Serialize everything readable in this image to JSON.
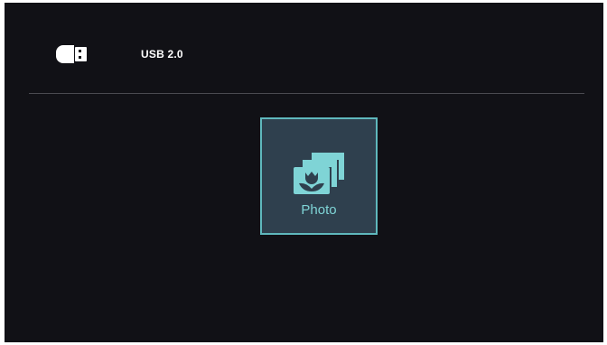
{
  "header": {
    "storage_icon": "usb-drive-icon",
    "storage_label": "USB 2.0"
  },
  "menu": {
    "items": [
      {
        "label": "Photo",
        "icon": "photo-icon",
        "selected": true
      }
    ]
  },
  "colors": {
    "background": "#111116",
    "tile_fill": "#2f404e",
    "tile_border": "#5fb8bd",
    "accent": "#7fd4d6"
  }
}
